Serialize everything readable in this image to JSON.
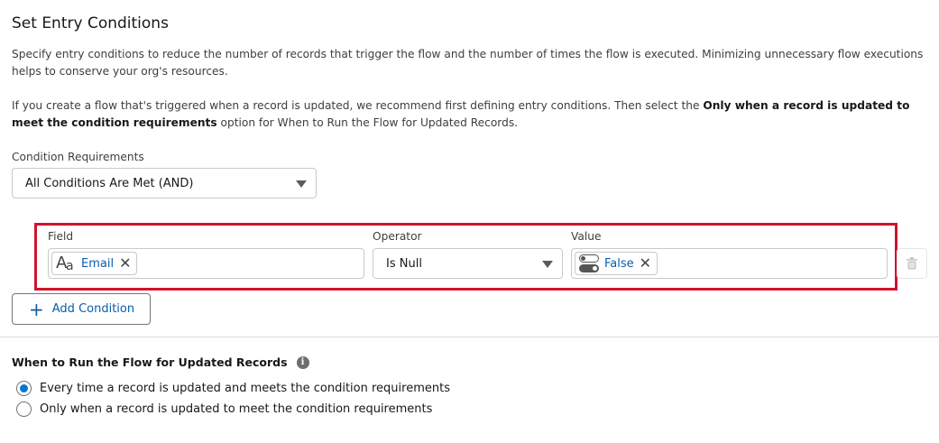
{
  "header": {
    "title": "Set Entry Conditions"
  },
  "description": {
    "para1": "Specify entry conditions to reduce the number of records that trigger the flow and the number of times the flow is executed. Minimizing unnecessary flow executions helps to conserve your org's resources.",
    "para2_pre": "If you create a flow that's triggered when a record is updated, we recommend first defining entry conditions. Then select the ",
    "para2_bold": "Only when a record is updated to meet the condition requirements",
    "para2_post": " option for When to Run the Flow for Updated Records."
  },
  "condition_requirements": {
    "label": "Condition Requirements",
    "selected": "All Conditions Are Met (AND)"
  },
  "condition_row": {
    "field_label": "Field",
    "field_value": "Email",
    "field_icon": "text-field-icon",
    "operator_label": "Operator",
    "operator_value": "Is Null",
    "value_label": "Value",
    "value_value": "False",
    "value_icon": "boolean-toggle-icon"
  },
  "add_condition": {
    "label": "Add Condition"
  },
  "run_section": {
    "title": "When to Run the Flow for Updated Records",
    "options": [
      {
        "label": "Every time a record is updated and meets the condition requirements",
        "checked": true
      },
      {
        "label": "Only when a record is updated to meet the condition requirements",
        "checked": false
      }
    ]
  },
  "colors": {
    "accent": "#0176d3",
    "link": "#0b5cab",
    "highlight": "#d0142c"
  }
}
